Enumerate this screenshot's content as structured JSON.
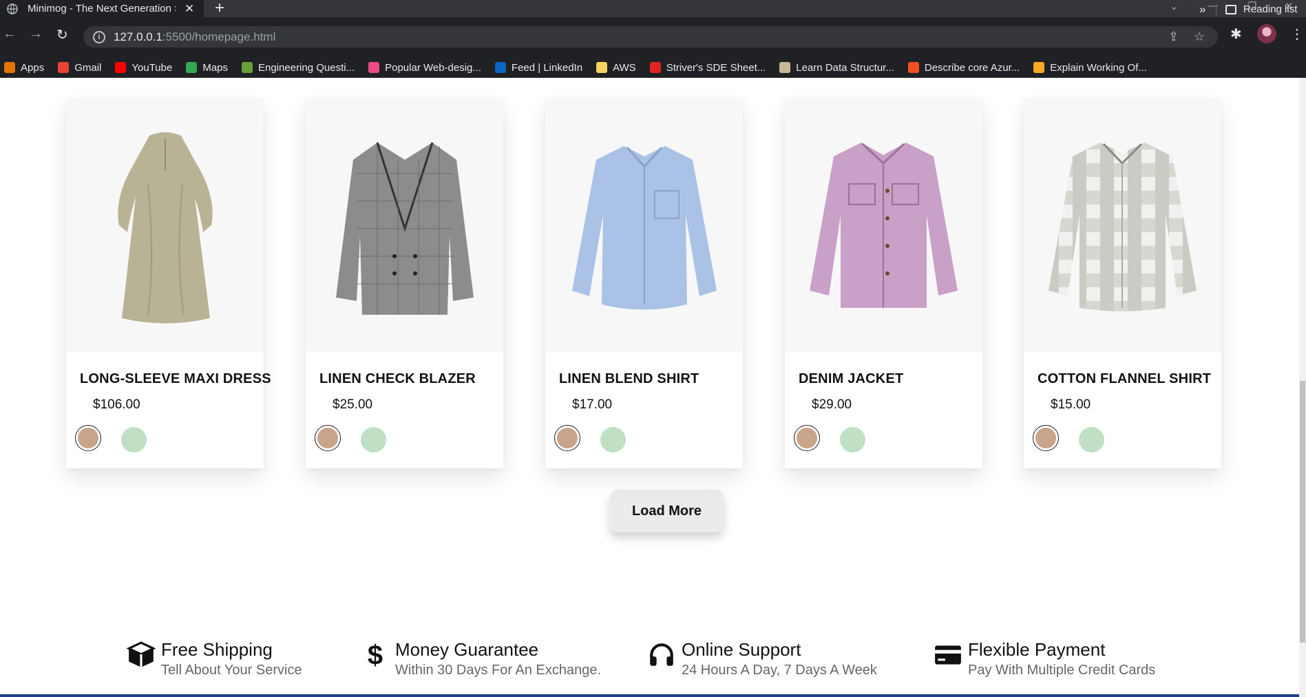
{
  "browser": {
    "tab_title": "Minimog - The Next Generation Shopify",
    "url_host": "127.0.0.1",
    "url_path": ":5500/homepage.html",
    "bookmarks": [
      {
        "label": "Apps",
        "icon": "apps-grid-icon",
        "color": "#e37400"
      },
      {
        "label": "Gmail",
        "icon": "gmail-icon",
        "color": "#ea4335"
      },
      {
        "label": "YouTube",
        "icon": "youtube-icon",
        "color": "#ff0000"
      },
      {
        "label": "Maps",
        "icon": "maps-icon",
        "color": "#34a853"
      },
      {
        "label": "Engineering Questi...",
        "icon": "leaf-icon",
        "color": "#6a9f3a"
      },
      {
        "label": "Popular Web-desig...",
        "icon": "dribbble-icon",
        "color": "#ea4c89"
      },
      {
        "label": "Feed | LinkedIn",
        "icon": "linkedin-icon",
        "color": "#0a66c2"
      },
      {
        "label": "AWS",
        "icon": "folder-icon",
        "color": "#f4d35e"
      },
      {
        "label": "Striver's SDE Sheet...",
        "icon": "tuf-icon",
        "color": "#e02424"
      },
      {
        "label": "Learn Data Structur...",
        "icon": "cc-icon",
        "color": "#c8b89a"
      },
      {
        "label": "Describe core Azur...",
        "icon": "microsoft-icon",
        "color": "#f25022"
      },
      {
        "label": "Explain Working Of...",
        "icon": "hook-icon",
        "color": "#f9a825"
      }
    ],
    "more_label": "»",
    "reading_list": "Reading list"
  },
  "products": [
    {
      "name": "LONG-SLEEVE MAXI DRESS",
      "price": "$106.00",
      "garment": "dress",
      "color": "#b9b395"
    },
    {
      "name": "LINEN CHECK BLAZER",
      "price": "$25.00",
      "garment": "blazer",
      "color": "#8c8c8c"
    },
    {
      "name": "LINEN BLEND SHIRT",
      "price": "$17.00",
      "garment": "shirt",
      "color": "#a9c2e6"
    },
    {
      "name": "DENIM JACKET",
      "price": "$29.00",
      "garment": "jacket",
      "color": "#c9a0c7"
    },
    {
      "name": "COTTON FLANNEL SHIRT",
      "price": "$15.00",
      "garment": "flannel",
      "color": "#c9ccc4"
    }
  ],
  "swatch_colors": {
    "selected": "#c9a48a",
    "alt": "#bfe0c4"
  },
  "load_more_label": "Load More",
  "features": [
    {
      "title": "Free Shipping",
      "subtitle": "Tell About Your Service",
      "icon": "box-icon"
    },
    {
      "title": "Money Guarantee",
      "subtitle": "Within 30 Days For An Exchange.",
      "icon": "dollar-icon"
    },
    {
      "title": "Online Support",
      "subtitle": "24 Hours A Day, 7 Days A Week",
      "icon": "headset-icon"
    },
    {
      "title": "Flexible Payment",
      "subtitle": "Pay With Multiple Credit Cards",
      "icon": "credit-card-icon"
    }
  ]
}
